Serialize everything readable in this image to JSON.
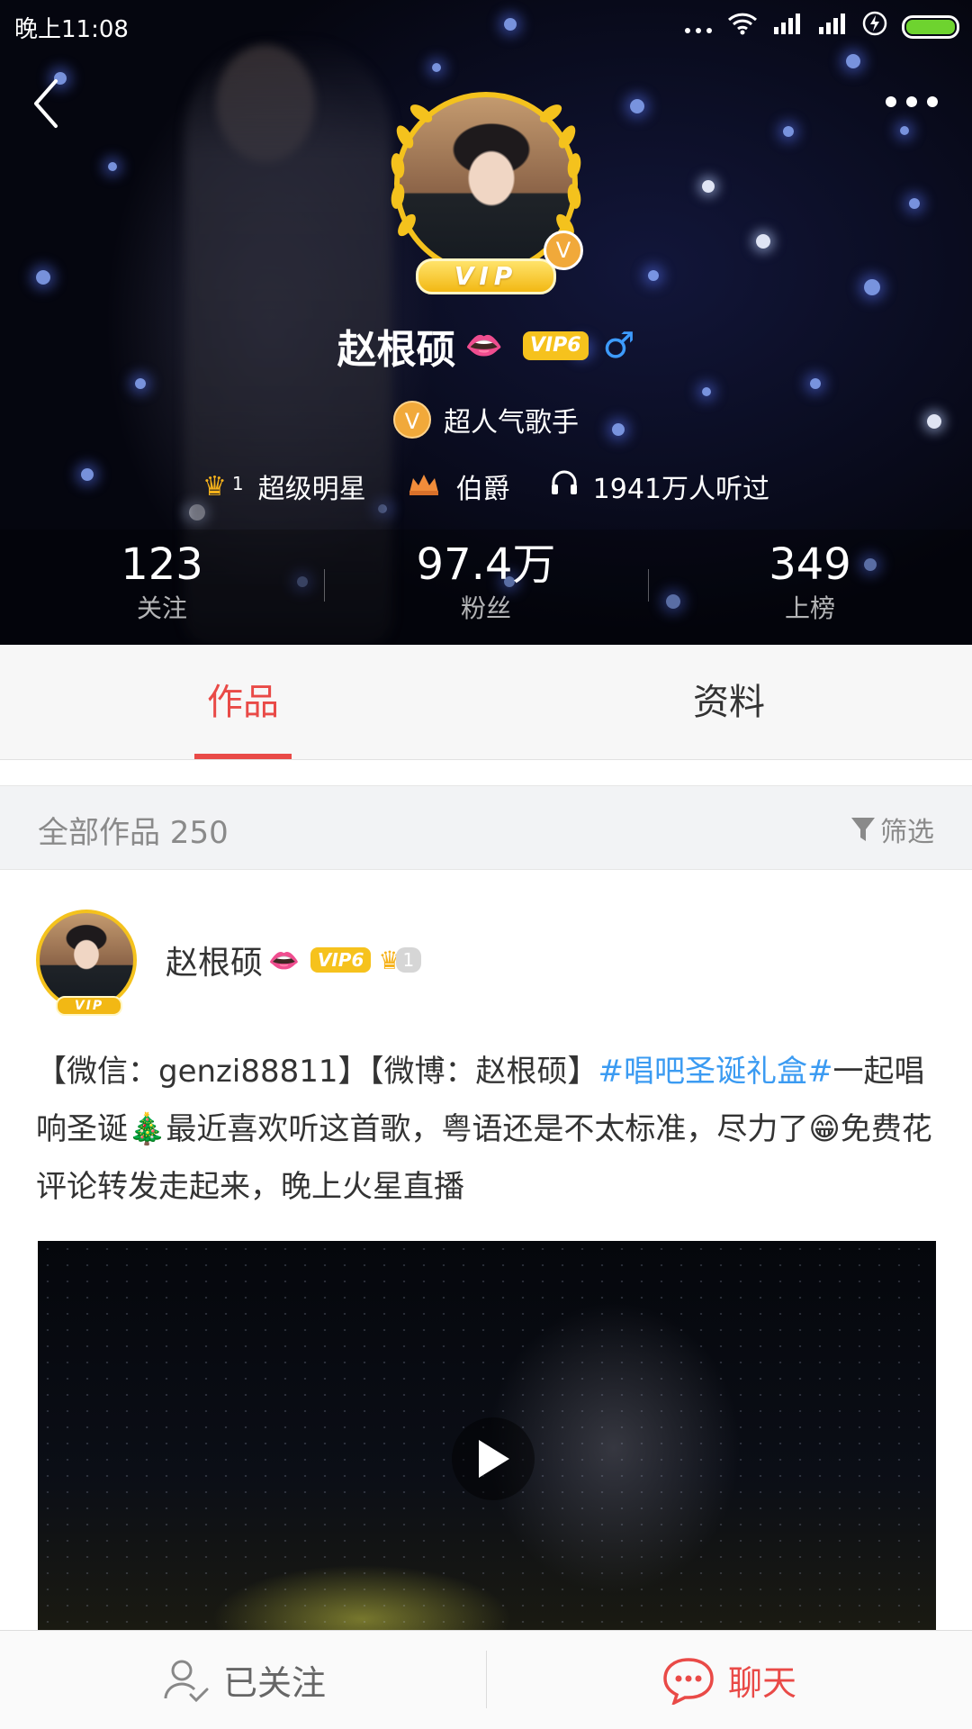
{
  "status_bar": {
    "time": "晚上11:08"
  },
  "profile": {
    "name": "赵根硕",
    "vip_ribbon": "VIP",
    "verified_badge": "V",
    "vip_level": "VIP6",
    "gender_symbol": "♂",
    "title": "超人气歌手",
    "crown_level": "1",
    "rank_title": "超级明星",
    "noble_title": "伯爵",
    "listeners": "1941万人听过"
  },
  "stats": [
    {
      "value": "123",
      "label": "关注"
    },
    {
      "value": "97.4万",
      "label": "粉丝"
    },
    {
      "value": "349",
      "label": "上榜"
    }
  ],
  "tabs": [
    {
      "label": "作品",
      "active": true
    },
    {
      "label": "资料",
      "active": false
    }
  ],
  "works_bar": {
    "label": "全部作品 250",
    "filter_label": "筛选"
  },
  "post": {
    "author": "赵根硕",
    "vip_level": "VIP6",
    "mini_vip": "VIP",
    "crown_level": "1",
    "text_prefix": "【微信：genzi88811】【微博：赵根硕】",
    "hashtag": "#唱吧圣诞礼盒#",
    "text_mid": "一起唱响圣诞",
    "emoji_tree": "🎄",
    "text_mid2": "最近喜欢听这首歌，粤语还是不太标准，尽力了",
    "emoji_grin": "😁",
    "text_suffix": "免费花评论转发走起来，晚上火星直播"
  },
  "bottom_bar": {
    "follow_label": "已关注",
    "chat_label": "聊天"
  },
  "colors": {
    "accent_red": "#e94a47",
    "vip_gold": "#f6c21d",
    "hashtag_blue": "#3b9bf2",
    "battery_green": "#6ed32f"
  }
}
